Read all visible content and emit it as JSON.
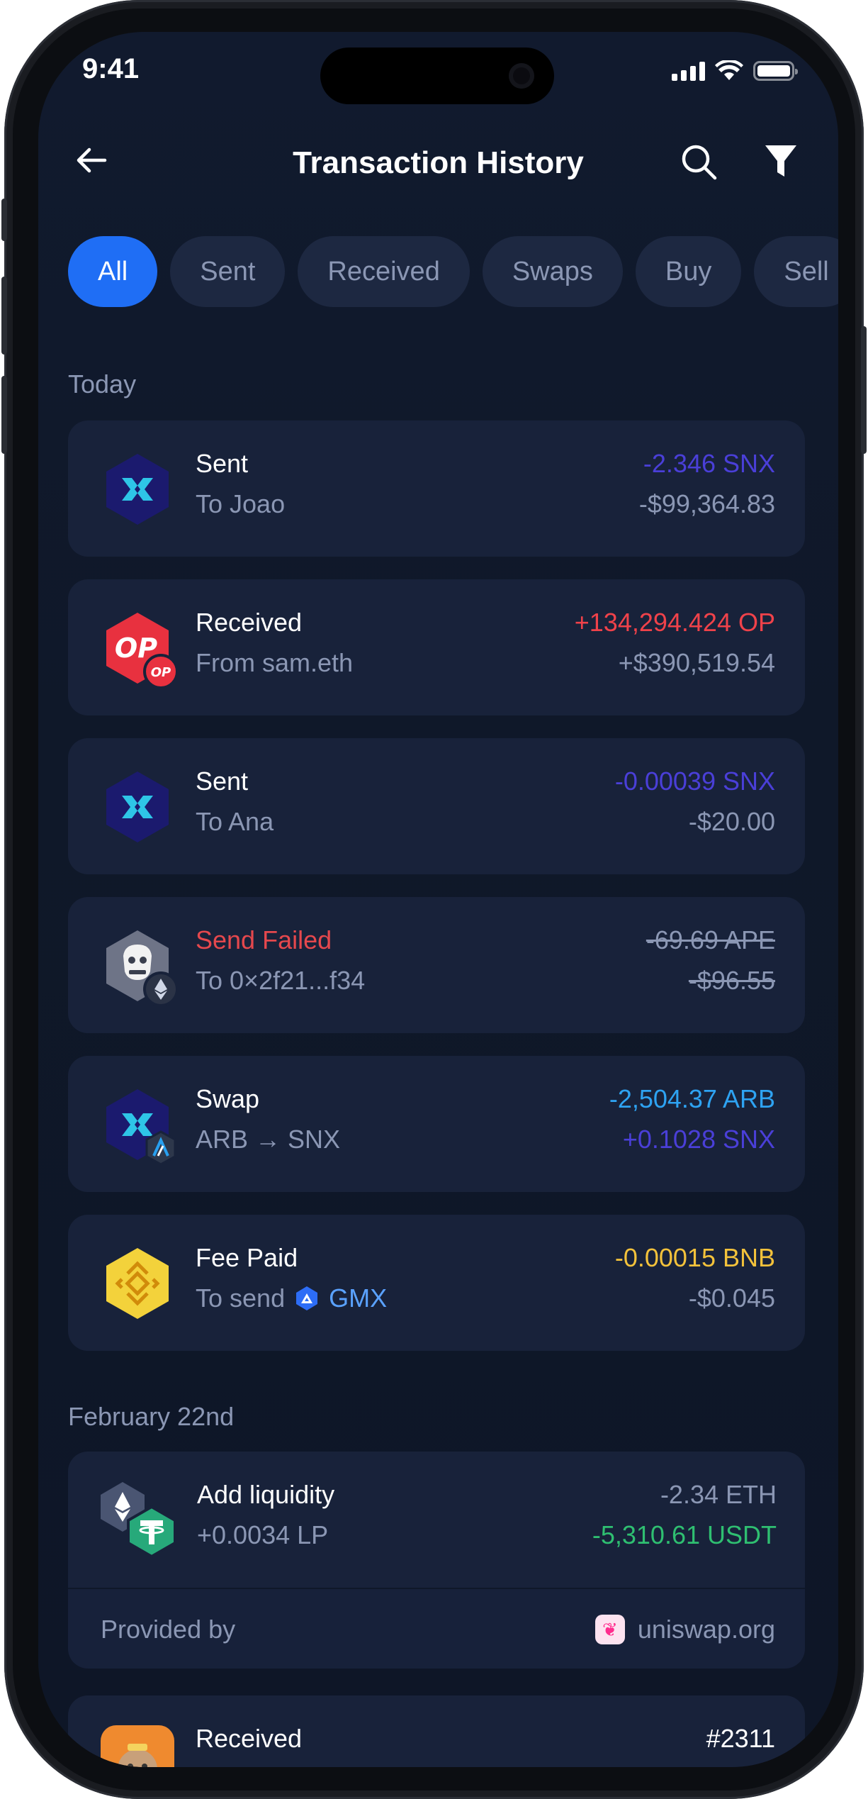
{
  "status": {
    "time": "9:41"
  },
  "header": {
    "title": "Transaction History"
  },
  "filters": [
    "All",
    "Sent",
    "Received",
    "Swaps",
    "Buy",
    "Sell"
  ],
  "active_filter": "All",
  "sections": [
    {
      "label": "Today"
    },
    {
      "label": "February 22nd"
    }
  ],
  "transactions": [
    {
      "title": "Sent",
      "subtitle": "To Joao",
      "amount": "-2.346 SNX",
      "fiat": "-$99,364.83",
      "icon": "synthetix-icon"
    },
    {
      "title": "Received",
      "subtitle": "From sam.eth",
      "amount": "+134,294.424 OP",
      "fiat": "+$390,519.54",
      "icon": "optimism-icon"
    },
    {
      "title": "Sent",
      "subtitle": "To Ana",
      "amount": "-0.00039 SNX",
      "fiat": "-$20.00",
      "icon": "synthetix-icon"
    },
    {
      "title": "Send Failed",
      "subtitle": "To 0×2f21...f34",
      "amount": "-69.69 APE",
      "fiat": "-$96.55",
      "icon": "apecoin-icon"
    },
    {
      "title": "Swap",
      "subtitle": "ARB → SNX",
      "amount": "-2,504.37 ARB",
      "fiat": "+0.1028 SNX",
      "icon": "synthetix-icon"
    },
    {
      "title": "Fee Paid",
      "subtitle": "To send",
      "subtitle_token": "GMX",
      "amount": "-0.00015 BNB",
      "fiat": "-$0.045",
      "icon": "bnb-icon"
    },
    {
      "title": "Add liquidity",
      "subtitle": "+0.0034 LP",
      "amount": "-2.34 ETH",
      "fiat": "-5,310.61 USDT",
      "icon": "ethereum-tether-icon"
    },
    {
      "title": "Received",
      "subtitle": "",
      "amount": "#2311",
      "fiat": "",
      "icon": "nft-icon"
    }
  ],
  "provided": {
    "label": "Provided by",
    "source": "uniswap.org"
  },
  "colors": {
    "accent": "#1f6ef5",
    "snx": "#4a3fd8",
    "op_red": "#f0424a",
    "failed": "#e5484d",
    "arb": "#2ea3f2",
    "bnb": "#f3c23b",
    "usdt": "#2fbf71",
    "muted": "#8b97b4"
  }
}
